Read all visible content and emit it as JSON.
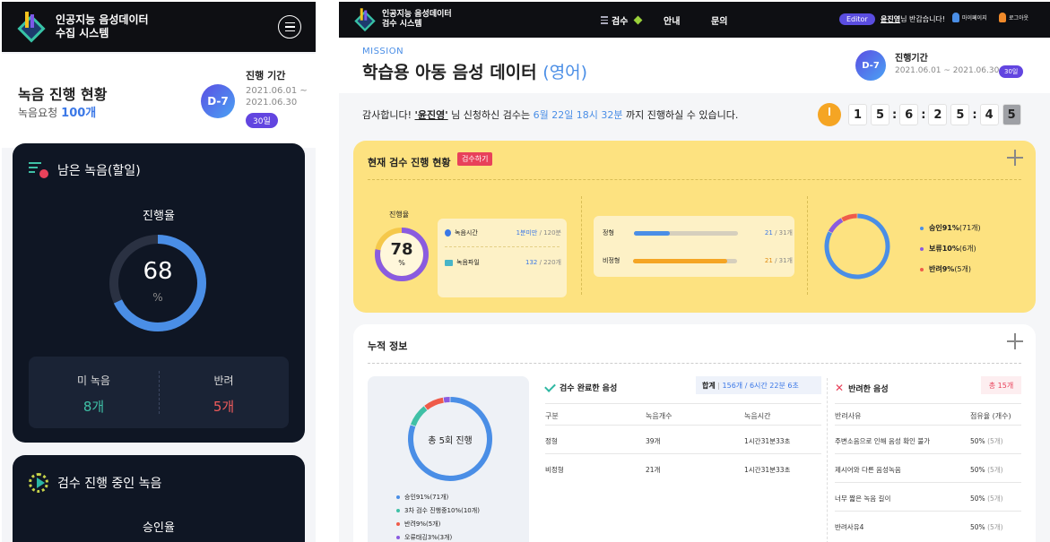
{
  "mobile": {
    "header": {
      "title_line1": "인공지능 음성데이터",
      "title_line2": "수집 시스템"
    },
    "summary": {
      "title": "녹음 진행 현황",
      "request_label": "녹음요청",
      "request_count": "100개",
      "dday": "D-7",
      "period_label": "진행 기간",
      "period_start": "2021.06.01 ~",
      "period_end": "2021.06.30",
      "days": "30일"
    },
    "remaining": {
      "title": "남은 녹음(할일)",
      "progress_label": "진행율",
      "progress": 68,
      "unit": "%",
      "unrecorded_label": "미 녹음",
      "unrecorded_value": "8개",
      "rejected_label": "반려",
      "rejected_value": "5개"
    },
    "reviewing": {
      "title": "검수 진행 중인 녹음",
      "approval_label": "승인율"
    }
  },
  "desktop": {
    "header": {
      "title_line1": "인공지능 음성데이터",
      "title_line2": "검수 시스템",
      "nav": [
        "검수",
        "안내",
        "문의"
      ],
      "role": "Editor",
      "user_name": "윤진영",
      "greeting_suffix": "님 반갑습니다!",
      "mypage": "마이페이지",
      "logout": "로그아웃"
    },
    "mission": {
      "label": "MISSION",
      "title": "학습용 아동 음성 데이터",
      "lang": "(영어)",
      "dday": "D-7",
      "period_label": "진행기간",
      "period": "2021.06.01 ~ 2021.06.30",
      "days": "30일"
    },
    "notice": {
      "p1": "감사합니다! ",
      "name": "'윤진영'",
      "p2": " 님 신청하신 검수는 ",
      "deadline": "6월 22일 18시 32분",
      "p3": " 까지 진행하실 수 있습니다."
    },
    "countdown": [
      "1",
      "5",
      "6",
      "2",
      "5",
      "4",
      "5"
    ],
    "current": {
      "title": "현재 검수 진행 현황",
      "button": "검수하기",
      "progress_label": "진행율",
      "progress": 78,
      "unit": "%",
      "time_label": "녹음시간",
      "time_value": "1분미만",
      "time_total": " / 120분",
      "file_label": "녹음파일",
      "file_value": "132",
      "file_total": " / 220개",
      "bars": [
        {
          "label": "정형",
          "value": "21",
          "total": " / 31개",
          "fraction": 0.35,
          "color": "#4a8ee6",
          "vcolor": "#3b78e7"
        },
        {
          "label": "비정형",
          "value": "21",
          "total": " / 31개",
          "fraction": 0.9,
          "color": "#f5a524",
          "vcolor": "#e08a10"
        }
      ],
      "pie": [
        {
          "label": "승인91%",
          "count": "(71개)",
          "value": 91,
          "color": "#4a8ee6"
        },
        {
          "label": "보류10%",
          "count": "(6개)",
          "value": 10,
          "color": "#8a5be0"
        },
        {
          "label": "반려9%",
          "count": "(5개)",
          "value": 9,
          "color": "#ef5b4a"
        }
      ]
    },
    "cumulative": {
      "title": "누적 정보",
      "ring_text": "총 5회 진행",
      "legend": [
        {
          "label": "승인91%",
          "count": "(71개)",
          "color": "#4a8ee6",
          "value": 91
        },
        {
          "label": "3차 검수 진행중10%",
          "count": "(10개)",
          "color": "#3fc0a6",
          "value": 10
        },
        {
          "label": "반려9%",
          "count": "(5개)",
          "color": "#ef5b4a",
          "value": 9
        },
        {
          "label": "오류태깅3%",
          "count": "(3개)",
          "color": "#8a5be0",
          "value": 3
        }
      ],
      "done_title": "검수 완료한 음성",
      "total_label": "합계",
      "total_value": "156개 / 6시간 22분 6초",
      "cols": [
        "구분",
        "녹음개수",
        "녹음시간"
      ],
      "rows": [
        [
          "정형",
          "39개",
          "1시간31분33초"
        ],
        [
          "비정형",
          "21개",
          "1시간31분33초"
        ]
      ],
      "rej_title": "반려한 음성",
      "rej_total": "총 15개",
      "rej_cols": [
        "반려사유",
        "점유율 (개수)"
      ],
      "rej_rows": [
        [
          "주변소음으로 인해 음성 확인 불가",
          "50%",
          "(5개)"
        ],
        [
          "제시어와 다른 음성녹음",
          "50%",
          "(5개)"
        ],
        [
          "너무 짧은 녹음 길이",
          "50%",
          "(5개)"
        ],
        [
          "반려사유4",
          "50%",
          "(5개)"
        ]
      ]
    }
  }
}
